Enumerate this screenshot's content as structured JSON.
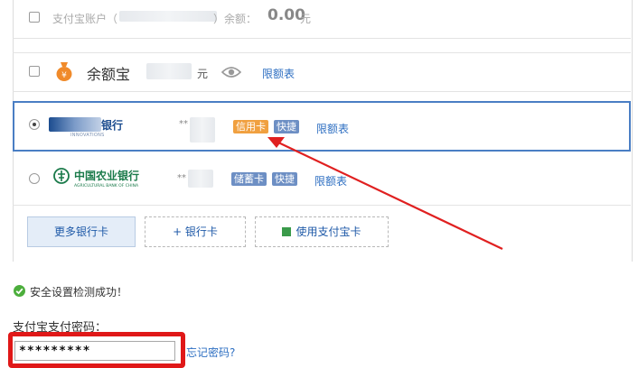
{
  "balance": {
    "label": "支付宝账户（",
    "label_suffix": "）余额：",
    "amount": "0.00",
    "unit": "元"
  },
  "yuebao": {
    "name": "余额宝",
    "unit": "元",
    "limit_link": "限额表"
  },
  "card_selected": {
    "bank_name": "银行",
    "bank_sub": "INNOVATIONS",
    "masked": "**",
    "tag_type": "信用卡",
    "tag_fast": "快捷",
    "limit_link": "限额表"
  },
  "card_abc": {
    "bank_name": "中国农业银行",
    "bank_en": "AGRICULTURAL BANK OF CHINA",
    "masked": "**",
    "tag_type": "储蓄卡",
    "tag_fast": "快捷",
    "limit_link": "限额表"
  },
  "buttons": {
    "more_cards": "更多银行卡",
    "add_card": "+ 银行卡",
    "use_alipay_card": "使用支付宝卡"
  },
  "security": {
    "message": "安全设置检测成功！"
  },
  "password": {
    "label": "支付宝支付密码：",
    "value": "*********",
    "forgot_link": "忘记密码?"
  },
  "colors": {
    "accent": "#2e6fc2",
    "selected_border": "#4a7ec4",
    "annotation_red": "#e02020",
    "credit_tag": "#f0a040",
    "fast_tag": "#6d8fc4"
  }
}
